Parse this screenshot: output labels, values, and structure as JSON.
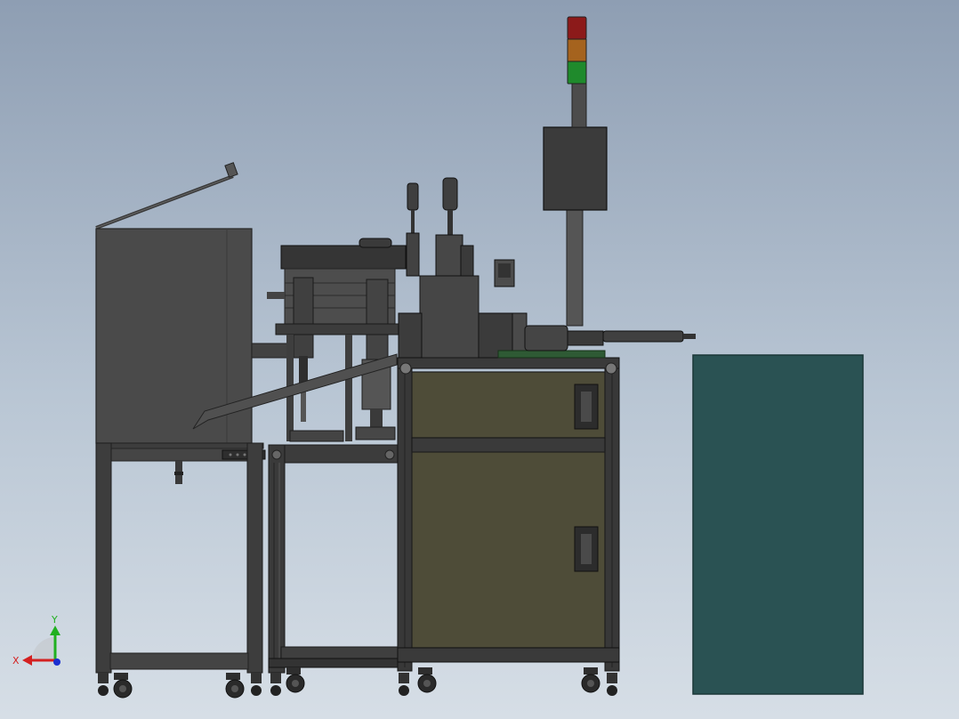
{
  "viewport": {
    "background_top": "#8e9eb3",
    "background_bottom": "#d6dee6"
  },
  "colors": {
    "frame_dark": "#3a3a3a",
    "frame_mid": "#4a4a4a",
    "panel_olive": "#4e4c38",
    "teal_box": "#2a5253",
    "tower_red": "#8c1a1a",
    "tower_amber": "#a5631e",
    "tower_green": "#1f8a2c",
    "axis_x": "#d42020",
    "axis_y": "#20b020"
  },
  "triad": {
    "x_label": "X",
    "y_label": "Y"
  }
}
